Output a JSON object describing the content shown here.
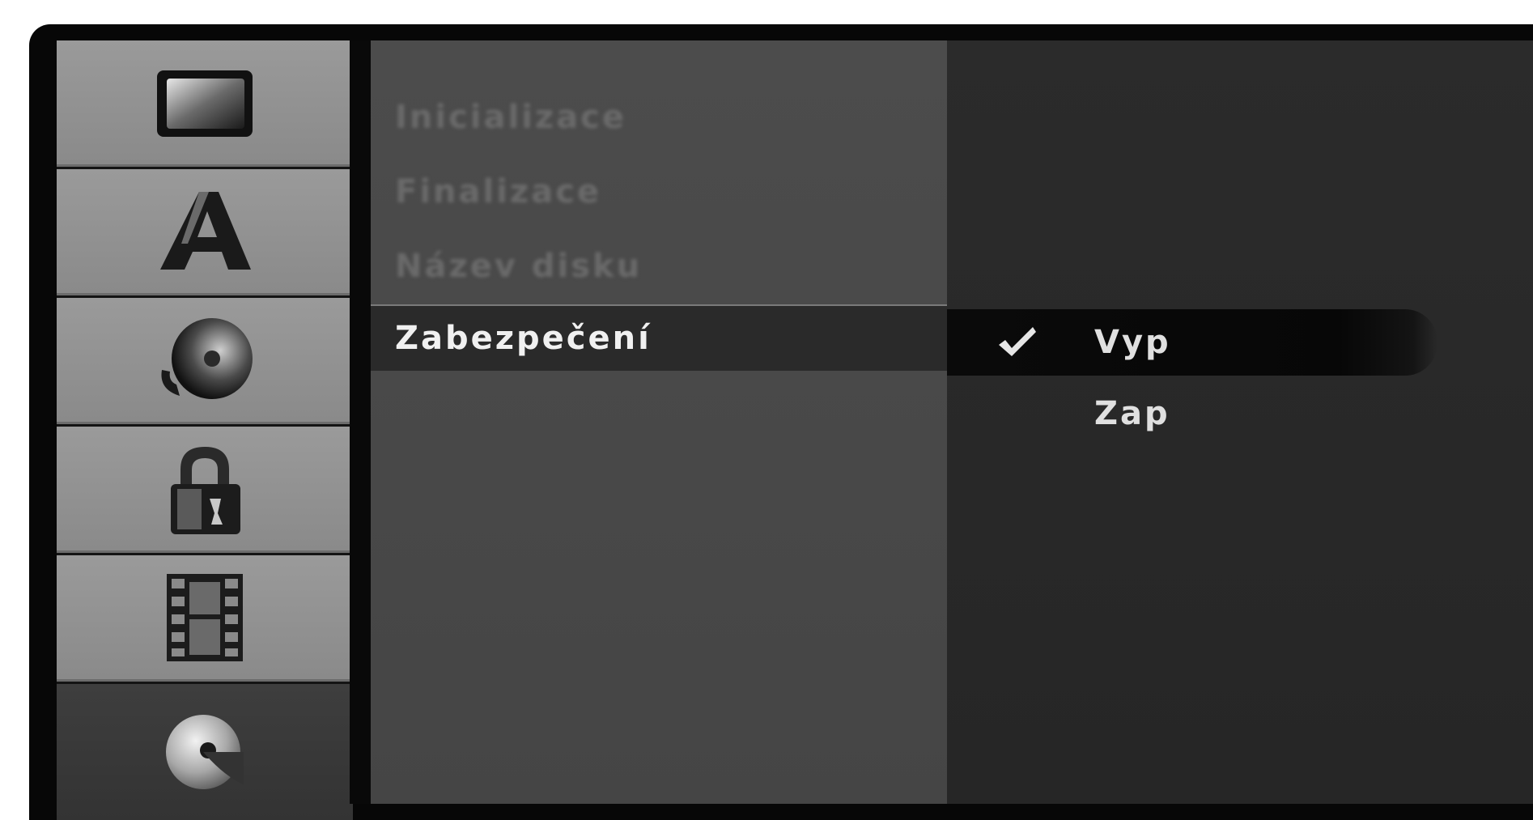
{
  "sidebar": {
    "items": [
      {
        "icon": "tv-screen-icon"
      },
      {
        "icon": "letter-a-icon"
      },
      {
        "icon": "audio-disc-icon"
      },
      {
        "icon": "lock-icon"
      },
      {
        "icon": "film-icon"
      },
      {
        "icon": "disc-settings-icon",
        "active": true
      }
    ]
  },
  "menu": {
    "items": [
      {
        "label": "Inicializace"
      },
      {
        "label": "Finalizace"
      },
      {
        "label": "Název disku"
      },
      {
        "label": "Zabezpečení"
      }
    ],
    "selected_index": 3
  },
  "options": {
    "items": [
      {
        "label": "Vyp",
        "checked": true
      },
      {
        "label": "Zap",
        "checked": false
      }
    ]
  },
  "colors": {
    "background": "#070707",
    "sidebar_tile": "#8f8f8f",
    "menu_panel": "#494949",
    "options_panel": "#292929",
    "text": "#f0f0f0"
  }
}
